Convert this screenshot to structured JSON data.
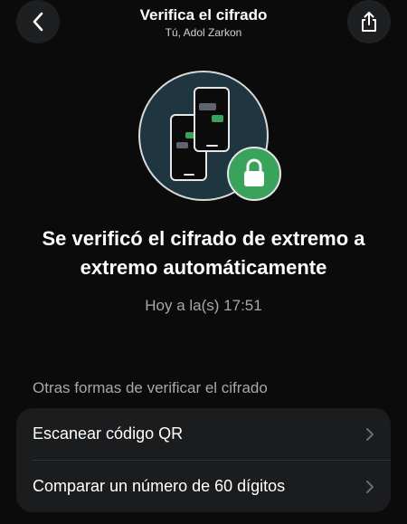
{
  "header": {
    "title": "Verifica el cifrado",
    "subtitle": "Tú, Adol Zarkon"
  },
  "icons": {
    "back": "chevron-left-icon",
    "share": "share-icon",
    "illustration": "phones-verification-icon",
    "lock": "lock-icon",
    "chevron": "chevron-right-icon"
  },
  "colors": {
    "background": "#0b0b0c",
    "accent_green": "#3aa35b",
    "circle_fill": "#1f3640",
    "card": "#1b1c1e"
  },
  "main": {
    "headline": "Se verificó el cifrado de extremo a extremo automáticamente",
    "timestamp": "Hoy a la(s) 17:51"
  },
  "other_methods": {
    "title": "Otras formas de verificar el cifrado",
    "options": [
      {
        "label": "Escanear código QR"
      },
      {
        "label": "Comparar un número de 60 dígitos"
      }
    ]
  }
}
